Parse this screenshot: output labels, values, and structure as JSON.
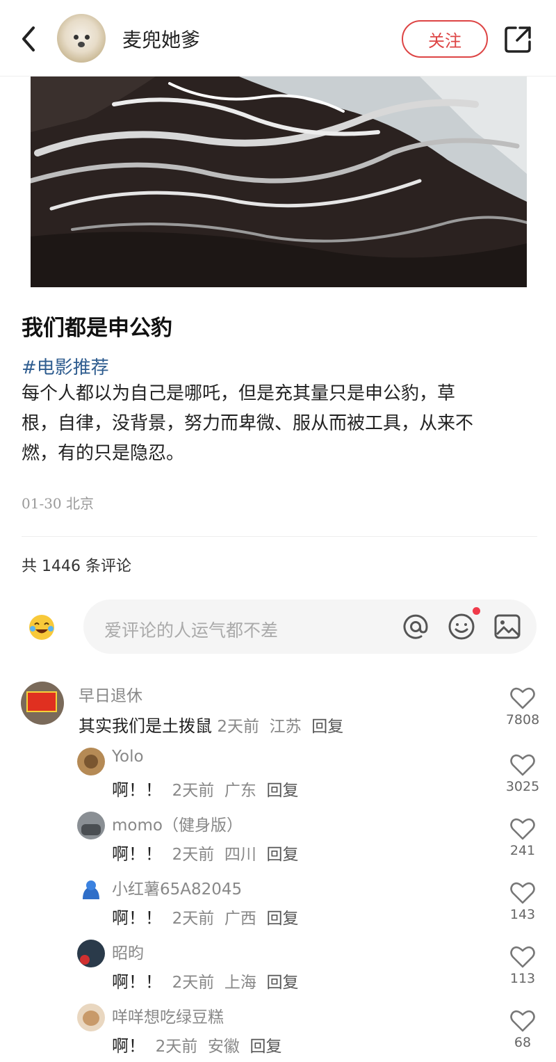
{
  "header": {
    "username": "麦兜她爹",
    "follow_label": "关注"
  },
  "post": {
    "title": "我们都是申公豹",
    "hashtag": "#电影推荐",
    "body_line1": "每个人都以为自己是哪吒，但是充其量只是申公豹，草",
    "body_line2": "根，自律，没背景，努力而卑微、服从而被工具，从来不",
    "body_line3": "燃，有的只是隐忍。",
    "date": "01-30",
    "location": "北京"
  },
  "comments_header": {
    "count_text": "共 1446 条评论"
  },
  "comment_input": {
    "placeholder": "爱评论的人运气都不差"
  },
  "comments": [
    {
      "name": "早日退休",
      "text": "其实我们是土拨鼠",
      "time": "2天前",
      "region": "江苏",
      "reply": "回复",
      "likes": "7808"
    },
    {
      "name": "Yolo",
      "text": "啊！！",
      "time": "2天前",
      "region": "广东",
      "reply": "回复",
      "likes": "3025"
    },
    {
      "name": "momo（健身版）",
      "text": "啊！！",
      "time": "2天前",
      "region": "四川",
      "reply": "回复",
      "likes": "241"
    },
    {
      "name": "小红薯65A82045",
      "text": "啊！！",
      "time": "2天前",
      "region": "广西",
      "reply": "回复",
      "likes": "143"
    },
    {
      "name": "昭昀",
      "text": "啊！！",
      "time": "2天前",
      "region": "上海",
      "reply": "回复",
      "likes": "113"
    },
    {
      "name": "咩咩想吃绿豆糕",
      "text": "啊！",
      "time": "2天前",
      "region": "安徽",
      "reply": "回复",
      "likes": "68"
    }
  ]
}
